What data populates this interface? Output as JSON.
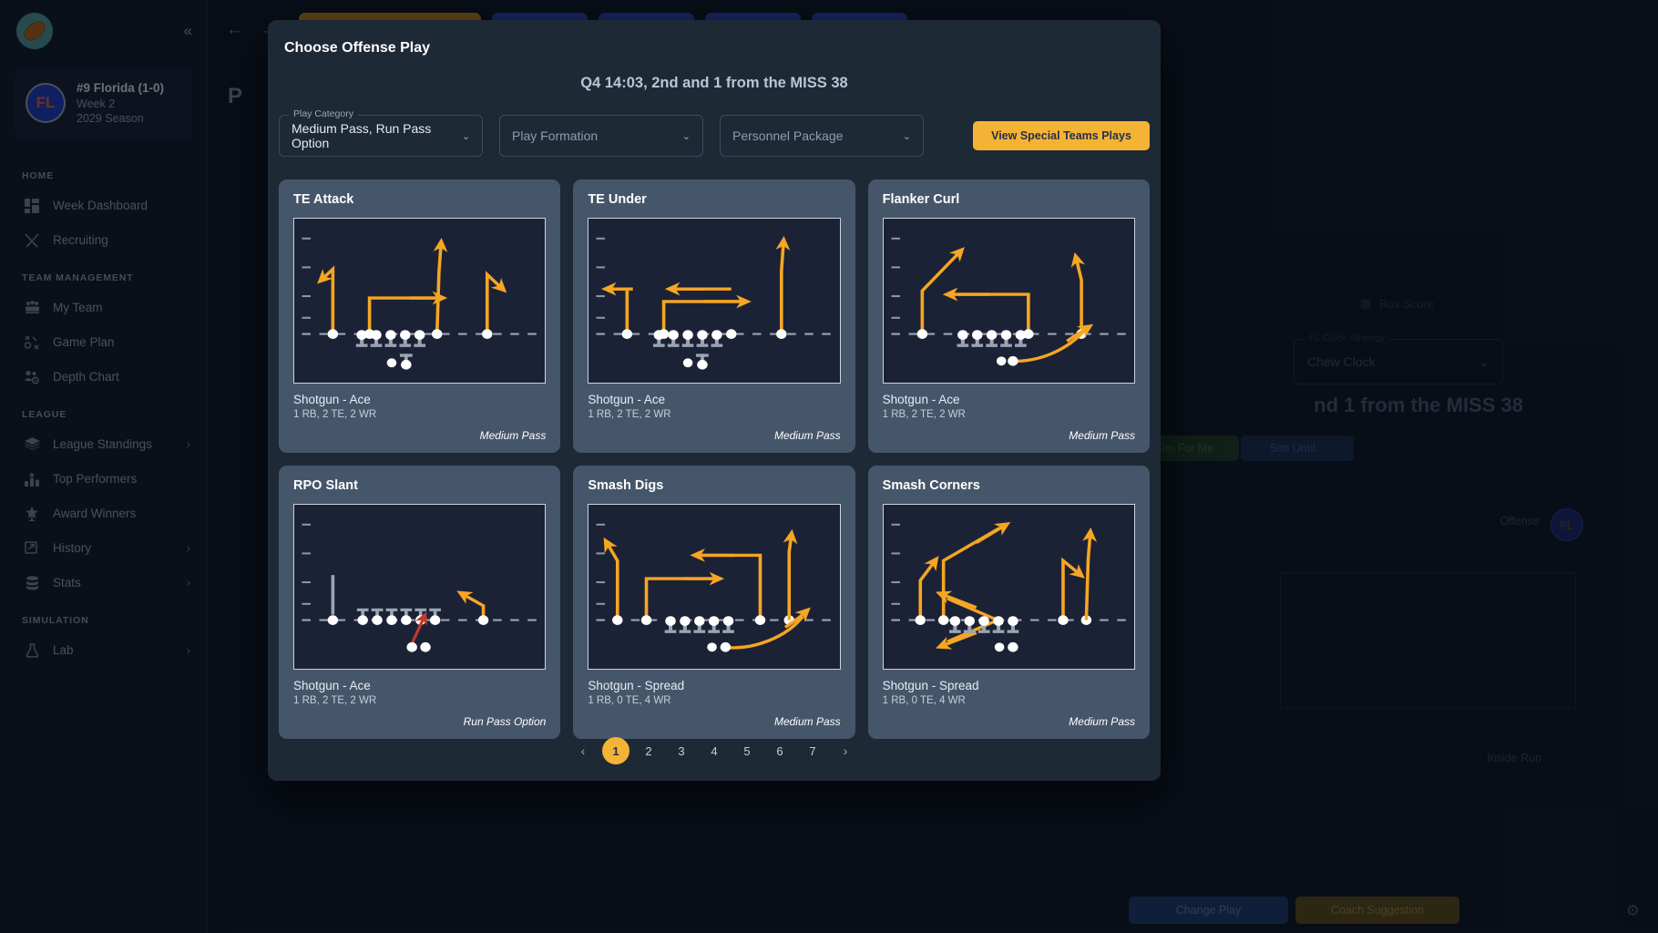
{
  "sidebar": {
    "logo_icon": "football-logo-icon",
    "collapse_icon": "«",
    "team": {
      "initials": "FL",
      "name": "#9 Florida (1-0)",
      "week": "Week 2",
      "season": "2029 Season"
    },
    "sections": [
      {
        "heading": "HOME",
        "items": [
          {
            "label": "Week Dashboard",
            "icon": "dashboard-icon",
            "chevron": ""
          },
          {
            "label": "Recruiting",
            "icon": "recruiting-icon",
            "chevron": ""
          }
        ]
      },
      {
        "heading": "TEAM MANAGEMENT",
        "items": [
          {
            "label": "My Team",
            "icon": "team-icon",
            "chevron": ""
          },
          {
            "label": "Game Plan",
            "icon": "gameplan-icon",
            "chevron": ""
          },
          {
            "label": "Depth Chart",
            "icon": "depthchart-icon",
            "chevron": ""
          }
        ]
      },
      {
        "heading": "LEAGUE",
        "items": [
          {
            "label": "League Standings",
            "icon": "layers-icon",
            "chevron": "›"
          },
          {
            "label": "Top Performers",
            "icon": "bar-chart-icon",
            "chevron": ""
          },
          {
            "label": "Award Winners",
            "icon": "star-icon",
            "chevron": ""
          },
          {
            "label": "History",
            "icon": "history-icon",
            "chevron": "›"
          },
          {
            "label": "Stats",
            "icon": "database-icon",
            "chevron": "›"
          }
        ]
      },
      {
        "heading": "SIMULATION",
        "items": [
          {
            "label": "Lab",
            "icon": "flask-icon",
            "chevron": "›"
          }
        ]
      }
    ]
  },
  "background": {
    "back_arrow": "←",
    "forward_arrow": "→",
    "tabs": [
      {
        "label": "",
        "style": "amber"
      },
      {
        "label": "",
        "style": "blue"
      },
      {
        "label": "",
        "style": "blue"
      },
      {
        "label": "",
        "style": "blue"
      },
      {
        "label": "",
        "style": "blue"
      }
    ],
    "page_title": "P",
    "box_score": "Box Score",
    "clock_strategy_label": "FL Clock Strategy",
    "clock_strategy_value": "Chew Clock",
    "situation": "nd 1 from the MISS 38",
    "sim_for_me": "Sim For Me",
    "sim_until": "Sim Until...",
    "offense_label": "Offense",
    "offense_team": "FL",
    "inside_run": "Inside Run",
    "change_play": "Change Play",
    "coach_suggestion": "Coach Suggestion",
    "gear_icon": "gear-icon"
  },
  "modal": {
    "title": "Choose Offense Play",
    "situation": "Q4 14:03, 2nd and 1 from the MISS 38",
    "filters": [
      {
        "legend": "Play Category",
        "value": "Medium Pass, Run Pass Option",
        "placeholder": "",
        "name": "play-category-select"
      },
      {
        "legend": "",
        "value": "Play Formation",
        "placeholder": "Play Formation",
        "name": "play-formation-select"
      },
      {
        "legend": "",
        "value": "Personnel Package",
        "placeholder": "Personnel Package",
        "name": "personnel-package-select"
      }
    ],
    "special_teams_button": "View Special Teams Plays",
    "plays": [
      {
        "name": "TE Attack",
        "formation": "Shotgun - Ace",
        "personnel": "1 RB, 2 TE, 2 WR",
        "type": "Medium Pass",
        "diagram": "te-attack"
      },
      {
        "name": "TE Under",
        "formation": "Shotgun - Ace",
        "personnel": "1 RB, 2 TE, 2 WR",
        "type": "Medium Pass",
        "diagram": "te-under"
      },
      {
        "name": "Flanker Curl",
        "formation": "Shotgun - Ace",
        "personnel": "1 RB, 2 TE, 2 WR",
        "type": "Medium Pass",
        "diagram": "flanker-curl"
      },
      {
        "name": "RPO Slant",
        "formation": "Shotgun - Ace",
        "personnel": "1 RB, 2 TE, 2 WR",
        "type": "Run Pass Option",
        "diagram": "rpo-slant"
      },
      {
        "name": "Smash Digs",
        "formation": "Shotgun - Spread",
        "personnel": "1 RB, 0 TE, 4 WR",
        "type": "Medium Pass",
        "diagram": "smash-digs"
      },
      {
        "name": "Smash Corners",
        "formation": "Shotgun - Spread",
        "personnel": "1 RB, 0 TE, 4 WR",
        "type": "Medium Pass",
        "diagram": "smash-corners"
      }
    ],
    "pagination": {
      "prev": "‹",
      "next": "›",
      "pages": [
        "1",
        "2",
        "3",
        "4",
        "5",
        "6",
        "7"
      ],
      "current": "1"
    }
  },
  "colors": {
    "accent": "#f5b335",
    "route": "#f5a623",
    "run_route": "#c0392b",
    "card_bg": "#46566a",
    "diagram_bg": "#1c2236",
    "modal_bg": "#1e2936"
  }
}
